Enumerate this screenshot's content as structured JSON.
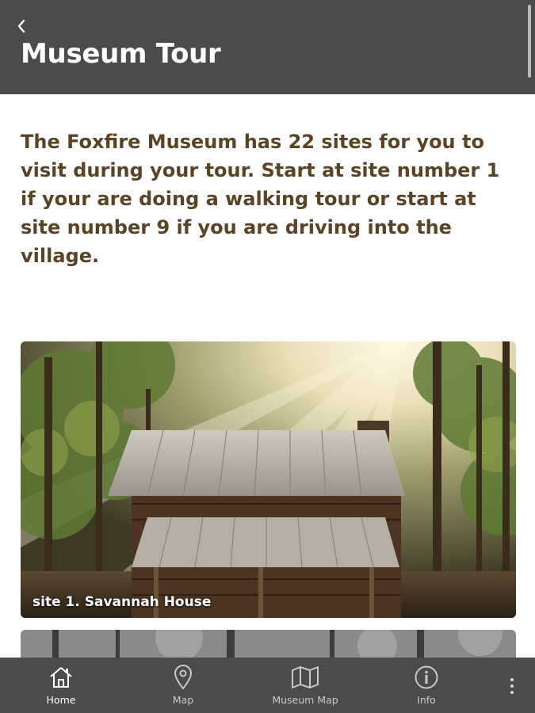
{
  "header": {
    "title": "Museum Tour",
    "back_icon": "chevron-left-icon",
    "background": "#4b4b4b"
  },
  "intro": {
    "text": "The Foxfire Museum has 22 sites for you to visit during your tour. Start at site number 1 if your are doing a walking tour or start at site number 9 if you are driving into the village.",
    "color": "#5b4426"
  },
  "sites": [
    {
      "caption": "site 1. Savannah House"
    }
  ],
  "bottom_nav": {
    "items": [
      {
        "label": "Home",
        "icon": "home-icon",
        "active": true
      },
      {
        "label": "Map",
        "icon": "map-pin-icon",
        "active": false
      },
      {
        "label": "Museum Map",
        "icon": "folded-map-icon",
        "active": false
      },
      {
        "label": "Info",
        "icon": "info-icon",
        "active": false
      }
    ],
    "more_icon": "more-vertical-icon"
  }
}
